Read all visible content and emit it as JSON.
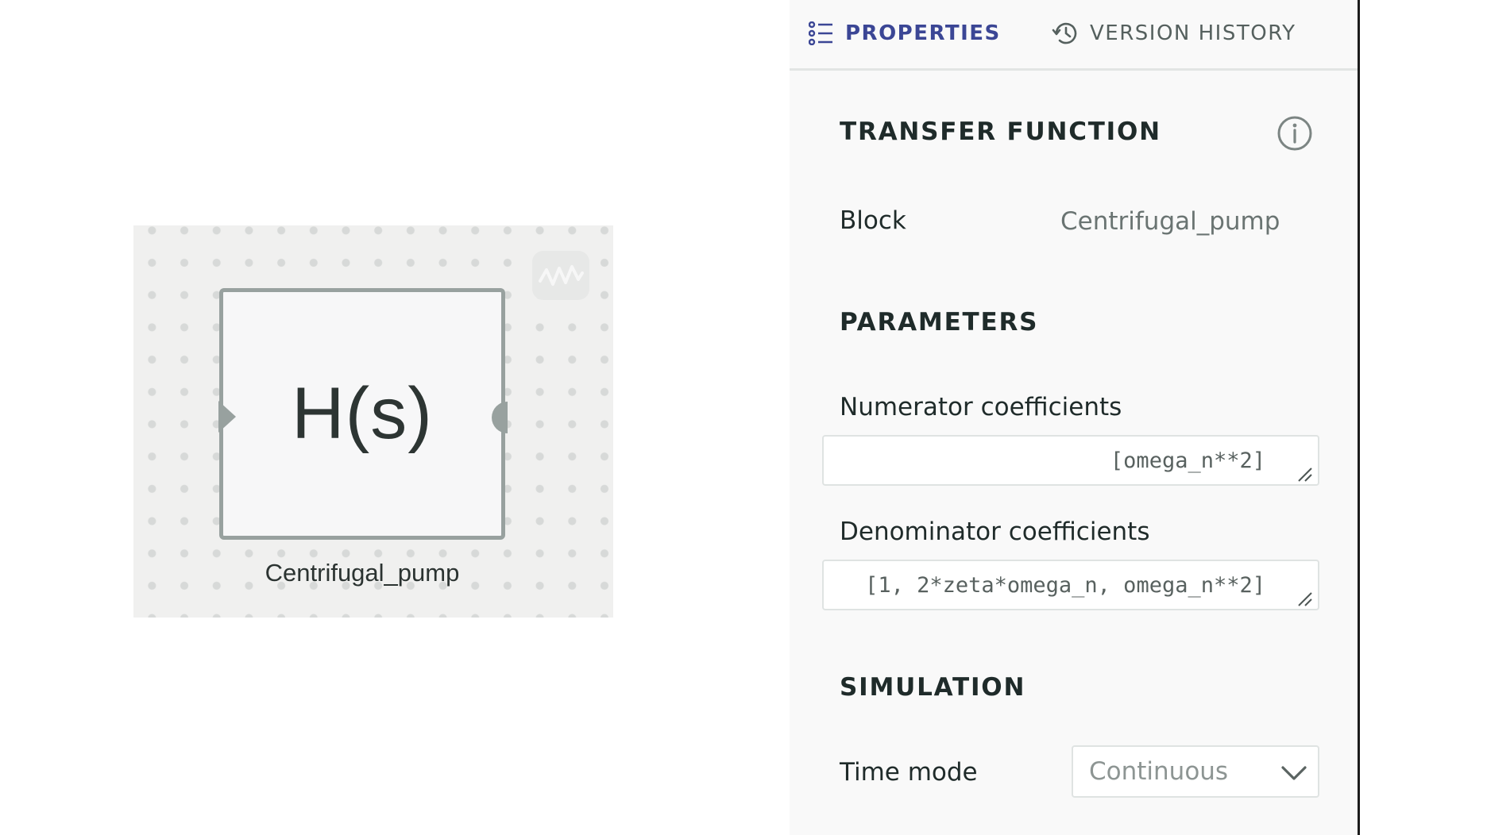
{
  "canvas": {
    "block_symbol": "H(s)",
    "block_name": "Centrifugal_pump",
    "mini_icon": "waveform-icon"
  },
  "tabs": {
    "properties": {
      "label": "PROPERTIES",
      "icon": "list-icon",
      "active": true
    },
    "version_history": {
      "label": "VERSION HISTORY",
      "icon": "history-icon"
    }
  },
  "panel": {
    "block_type_title": "TRANSFER FUNCTION",
    "info_icon": "info-icon",
    "block_row": {
      "label": "Block",
      "value": "Centrifugal_pump"
    },
    "parameters_title": "PARAMETERS",
    "numerator": {
      "label": "Numerator coefficients",
      "value": "[omega_n**2]"
    },
    "denominator": {
      "label": "Denominator coefficients",
      "value": "[1, 2*zeta*omega_n, omega_n**2]"
    },
    "simulation_title": "SIMULATION",
    "time_mode": {
      "label": "Time mode",
      "value": "Continuous",
      "icon": "chevron-down-icon"
    }
  },
  "colors": {
    "accent": "#3b4695",
    "block_border": "#98a19f",
    "canvas_bg": "#f0f0ef",
    "panel_bg": "#f9f9f9"
  }
}
